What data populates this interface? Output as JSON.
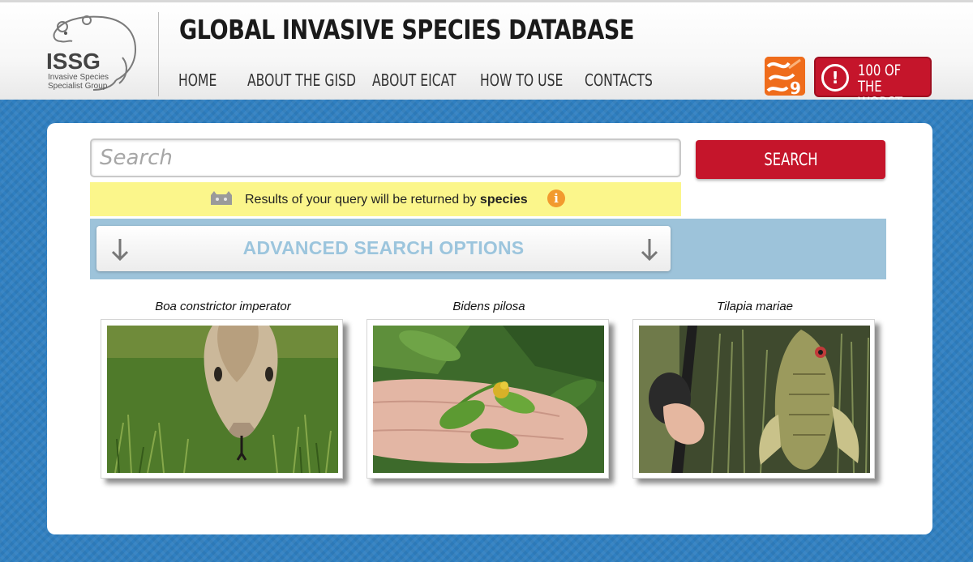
{
  "header": {
    "logo": {
      "acronym": "ISSG",
      "line1": "Invasive Species",
      "line2": "Specialist Group"
    },
    "title": "GLOBAL INVASIVE SPECIES DATABASE",
    "nav": [
      "HOME",
      "ABOUT THE GISD",
      "ABOUT EICAT",
      "HOW TO USE",
      "CONTACTS"
    ],
    "badge_number": "9",
    "worst_button": {
      "line1": "100 OF",
      "line2": "THE WORST",
      "icon": "!"
    }
  },
  "search": {
    "placeholder": "Search",
    "value": "",
    "button_label": "SEARCH"
  },
  "notice": {
    "prefix": "Results of your query will be returned by",
    "mode": "species",
    "info_icon": "i"
  },
  "advanced": {
    "label": "ADVANCED SEARCH OPTIONS"
  },
  "species_cards": [
    {
      "name": "Boa constrictor imperator",
      "image": "boa-photo"
    },
    {
      "name": "Bidens pilosa",
      "image": "bidens-photo"
    },
    {
      "name": "Tilapia mariae",
      "image": "tilapia-photo"
    }
  ],
  "colors": {
    "accent_red": "#c5152b",
    "background_blue": "#2f7fc1",
    "advanced_band": "#9dc3da",
    "notice_yellow": "#fbf68b",
    "info_orange": "#f29a2e"
  }
}
